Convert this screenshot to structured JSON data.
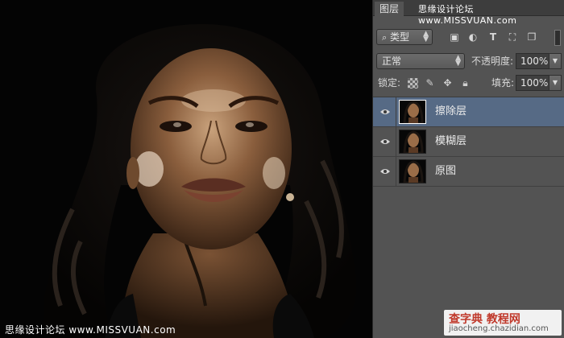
{
  "watermark": {
    "top": "思缘设计论坛 www.MISSVUAN.com",
    "bottom_left": "思缘设计论坛 www.MISSVUAN.com",
    "badge_title": "查字典 教程网",
    "badge_url": "jiaocheng.chazidian.com"
  },
  "panel": {
    "tab_label": "图层",
    "filter": {
      "icon": "search-icon",
      "label": "类型"
    },
    "filter_icons": [
      "image-icon",
      "circle-half-icon",
      "text-type-icon",
      "transform-icon",
      "smart-object-icon"
    ],
    "blend_mode": "正常",
    "opacity_label": "不透明度:",
    "opacity_value": "100%",
    "lock_label": "锁定:",
    "lock_icons": [
      "lock-transparent-icon",
      "lock-paint-icon",
      "lock-move-icon",
      "lock-all-icon"
    ],
    "fill_label": "填充:",
    "fill_value": "100%"
  },
  "layers": [
    {
      "name": "擦除层",
      "visible": true,
      "active": true
    },
    {
      "name": "模糊层",
      "visible": true,
      "active": false
    },
    {
      "name": "原图",
      "visible": true,
      "active": false
    }
  ],
  "colors": {
    "panel_bg": "#535353",
    "active_layer": "#566a85",
    "canvas_bg": "#040404"
  }
}
